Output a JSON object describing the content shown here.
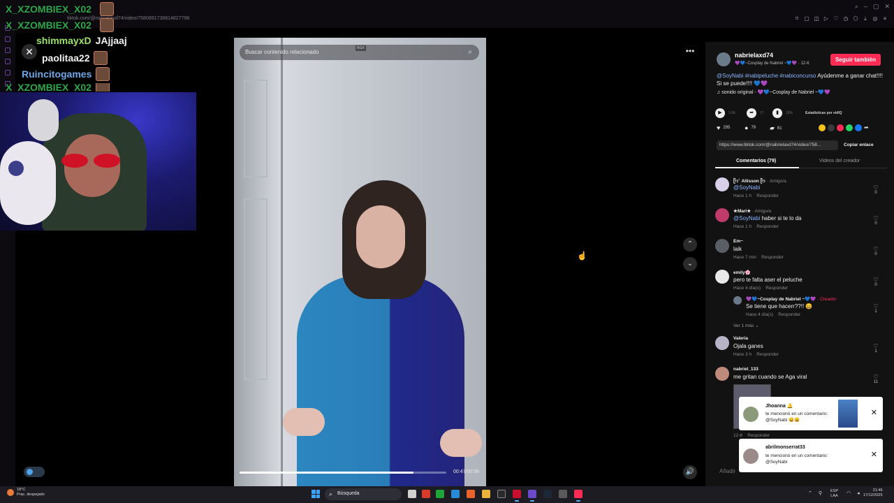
{
  "browser": {
    "url": "tiktok.com/@nabrielaxd74/video/7580891738814827796"
  },
  "chat": {
    "messages": [
      {
        "user": "X_XZOMBIEX_X02",
        "message": "",
        "color": "#2ea84b"
      },
      {
        "user": "X_XZOMBIEX_X02",
        "message": "",
        "color": "#2ea84b"
      },
      {
        "user": "shimmayxD",
        "message": "JAjjaaj",
        "color": "#9be36a"
      },
      {
        "user": "paolitaa22",
        "message": "",
        "color": "#f2f2f2"
      },
      {
        "user": "Ruincitogames",
        "message": "",
        "color": "#6ea7e8"
      },
      {
        "user": "X_XZOMBIEX_X02",
        "message": "",
        "color": "#2ea84b"
      }
    ]
  },
  "video": {
    "search_placeholder": "Buscar contenido relacionado",
    "badge": "RGX",
    "time": "00:47/00:56",
    "progress": 0.84
  },
  "author": {
    "username": "nabrielaxd74",
    "subtitle": "💜💙~Cosplay de Nabriel ~💙💜 · 12-6",
    "follow_label": "Seguir también",
    "description_tags": "@SoyNabi #nabipeluche #nabiconcurso",
    "description_text": " Ayúdenme a ganar chat!!!! Si se puede!!!! 💙💜",
    "sound": "♫  sonido original - 💜💙~Cosplay de Nabriel ~💙💜"
  },
  "stats": {
    "plays": "2.6K",
    "shares_small": "17",
    "percent": "16%",
    "stats_link": "Estadísticas por vidIQ",
    "likes": "295",
    "comments": "79",
    "saves": "61"
  },
  "share": {
    "link": "https://www.tiktok.com/@nabrielaxd74/video/758...",
    "copy_label": "Copiar enlace"
  },
  "tabs": {
    "comments": "Comentarios (79)",
    "creator_videos": "Videos del creador"
  },
  "comments": [
    {
      "name": "ᥫ᭡˚ Allisson ᥫ᭡",
      "badge": " · Amigo/a",
      "text_mention": "@SoyNabi",
      "text": "",
      "time": "Hace 1 h",
      "reply": "Responder",
      "likes": "0",
      "avatar": "#d8d0e8"
    },
    {
      "name": "★Mari★",
      "badge": " · Amigo/a",
      "text_mention": "@SoyNabi",
      "text": " haber si te lo da",
      "time": "Hace 1 h",
      "reply": "Responder",
      "likes": "0",
      "avatar": "#c03a6a"
    },
    {
      "name": "Em~",
      "badge": "",
      "text_mention": "",
      "text": "laik",
      "time": "Hace 7 min",
      "reply": "Responder",
      "likes": "0",
      "avatar": "#5a5e66"
    },
    {
      "name": "emily🌸",
      "badge": "",
      "text_mention": "",
      "text": "pero te falta aser el peluche",
      "time": "Hace 4 día(s)",
      "reply": "Responder",
      "likes": "0",
      "avatar": "#e8e8e8"
    },
    {
      "name": "Valeria",
      "badge": "",
      "text_mention": "",
      "text": "Ojala ganes",
      "time": "Hace 3 h",
      "reply": "Responder",
      "likes": "1",
      "avatar": "#b8b4c8"
    },
    {
      "name": "nabriel_133",
      "badge": "",
      "text_mention": "",
      "text": "me gritan cuando se Aga viral",
      "time": "12-6",
      "reply": "Responder",
      "likes": "11",
      "avatar": "#c08a7a"
    }
  ],
  "reply": {
    "name": "💜💙~Cosplay de Nabriel ~💙💜",
    "badge": " · Creador",
    "text": "Se tiene que hacerr??!! 😄",
    "time": "Hace 4 día(s)",
    "reply": "Responder",
    "likes": "1"
  },
  "see_more": "Ver 1 más ⌄",
  "notifications": [
    {
      "name": "Jhoanna 🔔",
      "message": "te mencionó en un comentario: @SoyNabi 😄😄"
    },
    {
      "name": "abrilmonserrat33",
      "message": "te mencionó en un comentario: @SoyNabi"
    }
  ],
  "add_comment_placeholder": "Añadir",
  "taskbar": {
    "weather_temp": "18°C",
    "weather_desc": "Prac. despejado",
    "search": "Búsqueda",
    "lang_1": "ESP",
    "lang_2": "LAA",
    "time": "21:46",
    "date": "17/12/2025"
  },
  "colors": {
    "accent": "#fe2c55",
    "mention": "#8ab4ff"
  }
}
